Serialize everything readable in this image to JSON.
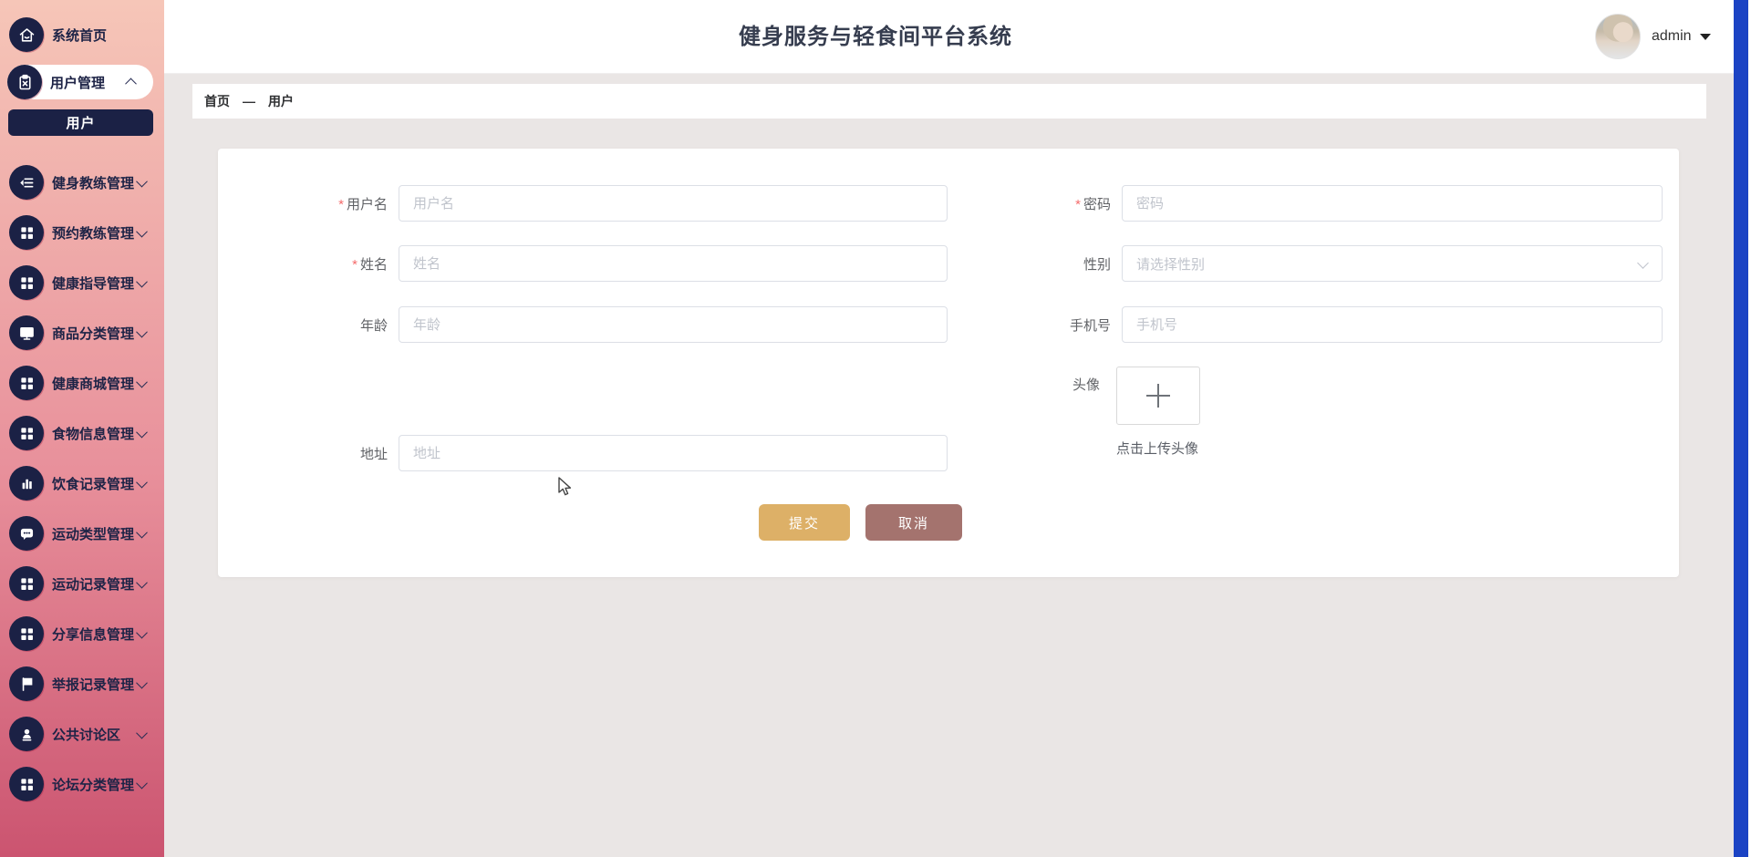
{
  "app": {
    "title": "健身服务与轻食间平台系统"
  },
  "header": {
    "user_name": "admin"
  },
  "breadcrumb": {
    "home": "首页",
    "separator": "—",
    "current": "用户"
  },
  "sidebar": {
    "items": [
      {
        "label": "系统首页",
        "icon": "home-icon",
        "has_children": false
      },
      {
        "label": "用户管理",
        "icon": "clipboard-icon",
        "has_children": true,
        "expanded": true,
        "children": [
          {
            "label": "用户",
            "active": true
          }
        ]
      },
      {
        "label": "健身教练管理",
        "icon": "list-icon",
        "has_children": true
      },
      {
        "label": "预约教练管理",
        "icon": "grid-icon",
        "has_children": true
      },
      {
        "label": "健康指导管理",
        "icon": "grid-icon",
        "has_children": true
      },
      {
        "label": "商品分类管理",
        "icon": "monitor-icon",
        "has_children": true
      },
      {
        "label": "健康商城管理",
        "icon": "grid-icon",
        "has_children": true
      },
      {
        "label": "食物信息管理",
        "icon": "grid-icon",
        "has_children": true
      },
      {
        "label": "饮食记录管理",
        "icon": "bar-chart-icon",
        "has_children": true
      },
      {
        "label": "运动类型管理",
        "icon": "chat-icon",
        "has_children": true
      },
      {
        "label": "运动记录管理",
        "icon": "grid-icon",
        "has_children": true
      },
      {
        "label": "分享信息管理",
        "icon": "grid-icon",
        "has_children": true
      },
      {
        "label": "举报记录管理",
        "icon": "flag-icon",
        "has_children": true
      },
      {
        "label": "公共讨论区",
        "icon": "user-icon",
        "has_children": true
      },
      {
        "label": "论坛分类管理",
        "icon": "grid-icon",
        "has_children": true
      }
    ]
  },
  "form": {
    "required_mark": "*",
    "left": [
      {
        "label": "用户名",
        "required": true,
        "placeholder": "用户名"
      },
      {
        "label": "姓名",
        "required": true,
        "placeholder": "姓名"
      },
      {
        "label": "年龄",
        "required": false,
        "placeholder": "年龄"
      },
      {
        "label": "地址",
        "required": false,
        "placeholder": "地址"
      }
    ],
    "right": [
      {
        "label": "密码",
        "required": true,
        "placeholder": "密码",
        "type": "input"
      },
      {
        "label": "性别",
        "required": false,
        "placeholder": "请选择性别",
        "type": "select"
      },
      {
        "label": "手机号",
        "required": false,
        "placeholder": "手机号",
        "type": "input"
      }
    ],
    "avatar_field": {
      "label": "头像",
      "hint": "点击上传头像"
    },
    "buttons": {
      "submit": "提交",
      "cancel": "取消"
    }
  },
  "colors": {
    "sidebar_gradient_top": "#f6c6b8",
    "sidebar_gradient_bottom": "#cb5470",
    "navy": "#1b2145",
    "content_bg": "#eae6e5",
    "submit_button": "#ddb067",
    "cancel_button": "#a4736e",
    "scrollbar_blue": "#1b43c4",
    "required_red": "#f56c6c"
  }
}
